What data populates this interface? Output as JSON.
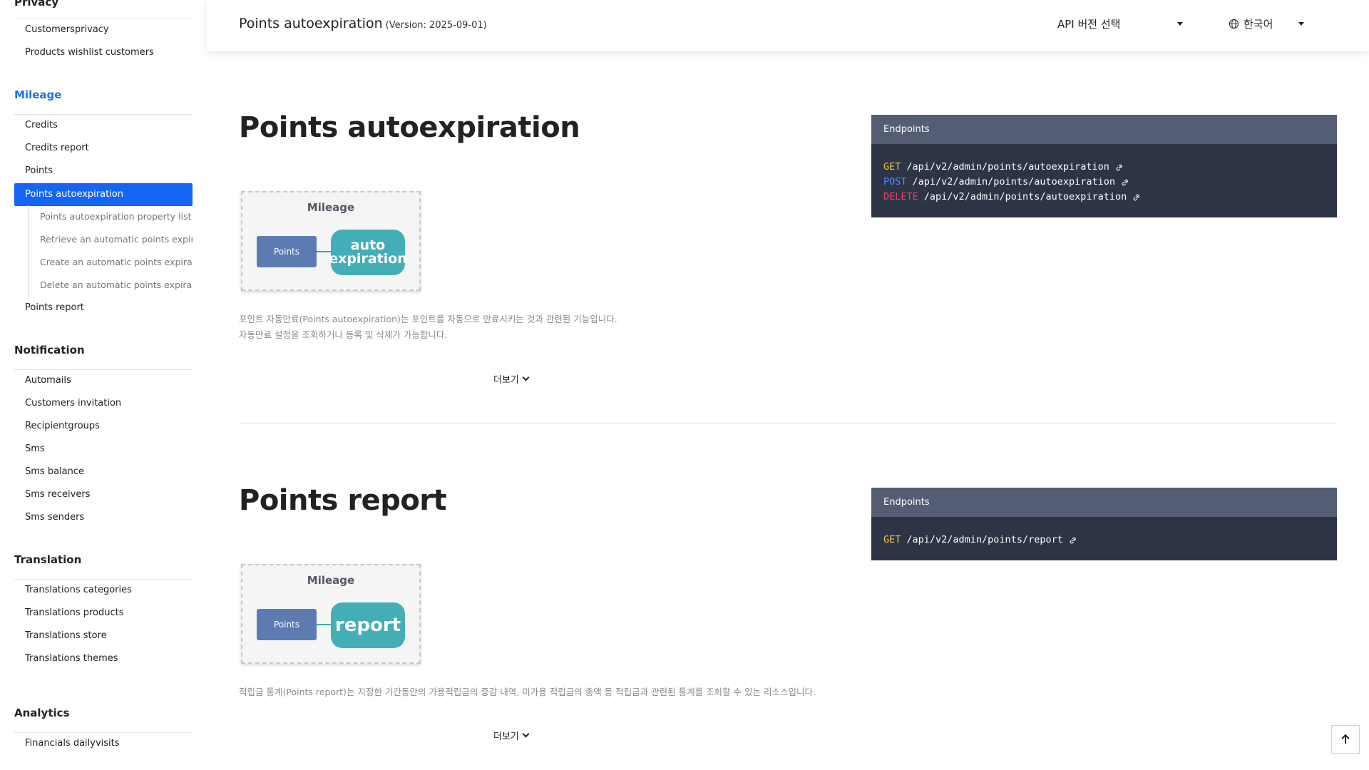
{
  "sidebar": {
    "privacy_title": "Privacy",
    "privacy_items": [
      "Customersprivacy",
      "Products wishlist customers"
    ],
    "mileage_title": "Mileage",
    "mileage_items": [
      "Credits",
      "Credits report",
      "Points",
      "Points autoexpiration"
    ],
    "mileage_sub": [
      "Points autoexpiration property list",
      "Retrieve an automatic points expiration",
      "Create an automatic points expiration",
      "Delete an automatic points expiration"
    ],
    "mileage_after": "Points report",
    "notification_title": "Notification",
    "notification_items": [
      "Automails",
      "Customers invitation",
      "Recipientgroups",
      "Sms",
      "Sms balance",
      "Sms receivers",
      "Sms senders"
    ],
    "translation_title": "Translation",
    "translation_items": [
      "Translations categories",
      "Translations products",
      "Translations store",
      "Translations themes"
    ],
    "analytics_title": "Analytics",
    "analytics_items": [
      "Financials dailyvisits"
    ]
  },
  "header": {
    "title": "Points autoexpiration",
    "version": "(Version: 2025-09-01)",
    "api_select": "API 버전 선택",
    "language": "한국어"
  },
  "sections": [
    {
      "title": "Points autoexpiration",
      "diagram": {
        "label": "Mileage",
        "left": "Points",
        "right": "auto expiration"
      },
      "desc": [
        "포인트 자동만료(Points autoexpiration)는 포인트를 자동으로 만료시키는 것과 관련된 기능입니다.",
        "자동만료 설정을 조회하거나 등록 및 삭제가 가능합니다."
      ],
      "more": "더보기",
      "endpoints_title": "Endpoints",
      "endpoints": [
        {
          "method": "GET",
          "path": "/api/v2/admin/points/autoexpiration"
        },
        {
          "method": "POST",
          "path": "/api/v2/admin/points/autoexpiration"
        },
        {
          "method": "DELETE",
          "path": "/api/v2/admin/points/autoexpiration"
        }
      ]
    },
    {
      "title": "Points report",
      "diagram": {
        "label": "Mileage",
        "left": "Points",
        "right": "report"
      },
      "desc": [
        "적립금 통계(Points report)는 지정한 기간동안의 가용적립금의 증감 내역, 미가용 적립금의 총액 등 적립금과 관련된 통계를 조회할 수 있는 리소스입니다."
      ],
      "more": "더보기",
      "endpoints_title": "Endpoints",
      "endpoints": [
        {
          "method": "GET",
          "path": "/api/v2/admin/points/report"
        }
      ]
    }
  ],
  "colors": {
    "get": "#f5c542",
    "post": "#4a8cf7",
    "delete": "#e8406a",
    "accent": "#1565f5"
  },
  "icons": {
    "language": "globe-icon",
    "endpoint_link": "link-icon",
    "scroll_top": "arrow-up-icon"
  }
}
